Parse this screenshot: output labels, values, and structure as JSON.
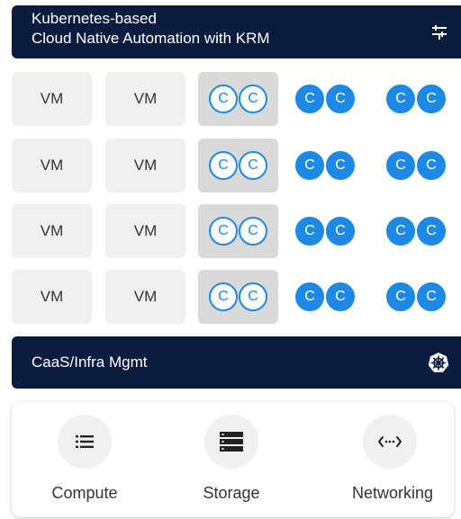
{
  "header": {
    "line1": "Kubernetes-based",
    "line2": "Cloud Native Automation with KRM",
    "icon": "tune-icon"
  },
  "grid": {
    "vm_label": "VM",
    "container_label": "C",
    "rows": [
      {
        "vms": [
          "VM",
          "VM"
        ],
        "containers": [
          "C",
          "C",
          "C",
          "C",
          "C",
          "C"
        ]
      },
      {
        "vms": [
          "VM",
          "VM"
        ],
        "containers": [
          "C",
          "C",
          "C",
          "C",
          "C",
          "C"
        ]
      },
      {
        "vms": [
          "VM",
          "VM"
        ],
        "containers": [
          "C",
          "C",
          "C",
          "C",
          "C",
          "C"
        ]
      },
      {
        "vms": [
          "VM",
          "VM"
        ],
        "containers": [
          "C",
          "C",
          "C",
          "C",
          "C",
          "C"
        ]
      }
    ]
  },
  "caas": {
    "title": "CaaS/Infra Mgmt",
    "icon": "kubernetes-icon"
  },
  "infra": {
    "items": [
      {
        "label": "Compute",
        "icon": "list-icon"
      },
      {
        "label": "Storage",
        "icon": "storage-icon"
      },
      {
        "label": "Networking",
        "icon": "code-arrows-icon"
      }
    ]
  },
  "colors": {
    "navy": "#0b1c3f",
    "blue": "#1e88e5",
    "vm_bg": "#f0f0f0",
    "container_box_bg": "#d9d9d9"
  }
}
